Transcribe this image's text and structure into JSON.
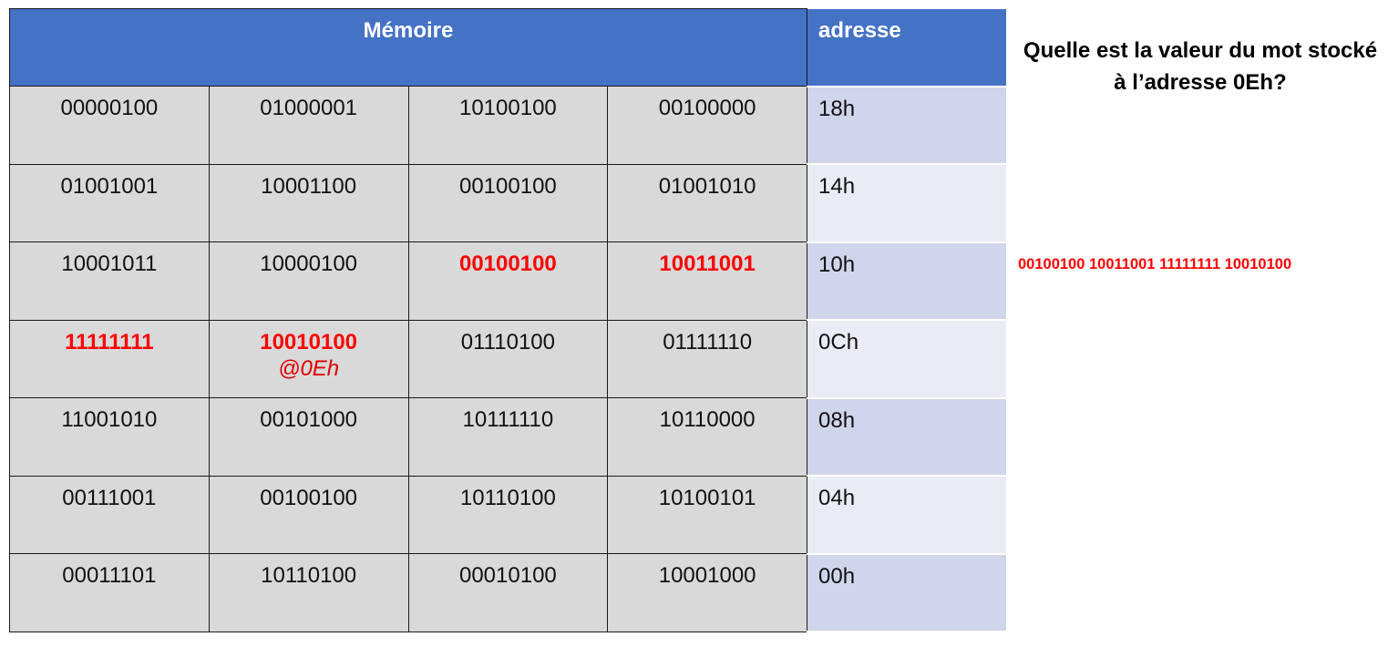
{
  "table": {
    "header_memory": "Mémoire",
    "header_address": "adresse",
    "rows": [
      {
        "bytes": [
          "00000100",
          "01000001",
          "10100100",
          "00100000"
        ],
        "address": "18h"
      },
      {
        "bytes": [
          "01001001",
          "10001100",
          "00100100",
          "01001010"
        ],
        "address": "14h"
      },
      {
        "bytes": [
          "10001011",
          "10000100",
          "00100100",
          "10011001"
        ],
        "address": "10h"
      },
      {
        "bytes": [
          "11111111",
          "10010100",
          "01110100",
          "01111110"
        ],
        "address": "0Ch",
        "note": "@0Eh"
      },
      {
        "bytes": [
          "11001010",
          "00101000",
          "10111110",
          "10110000"
        ],
        "address": "08h"
      },
      {
        "bytes": [
          "00111001",
          "00100100",
          "10110100",
          "10100101"
        ],
        "address": "04h"
      },
      {
        "bytes": [
          "00011101",
          "10110100",
          "00010100",
          "10001000"
        ],
        "address": "00h"
      }
    ]
  },
  "question": {
    "text": "Quelle est la valeur du mot stocké à l’adresse 0Eh?"
  },
  "answer": {
    "text": "00100100 10011001 11111111 10010100"
  },
  "colors": {
    "header_bg": "#4472c4",
    "cell_bg": "#d9d9d9",
    "address_dark": "#cfd5ea",
    "address_light": "#e9ebf5",
    "highlight": "#ff0000"
  }
}
